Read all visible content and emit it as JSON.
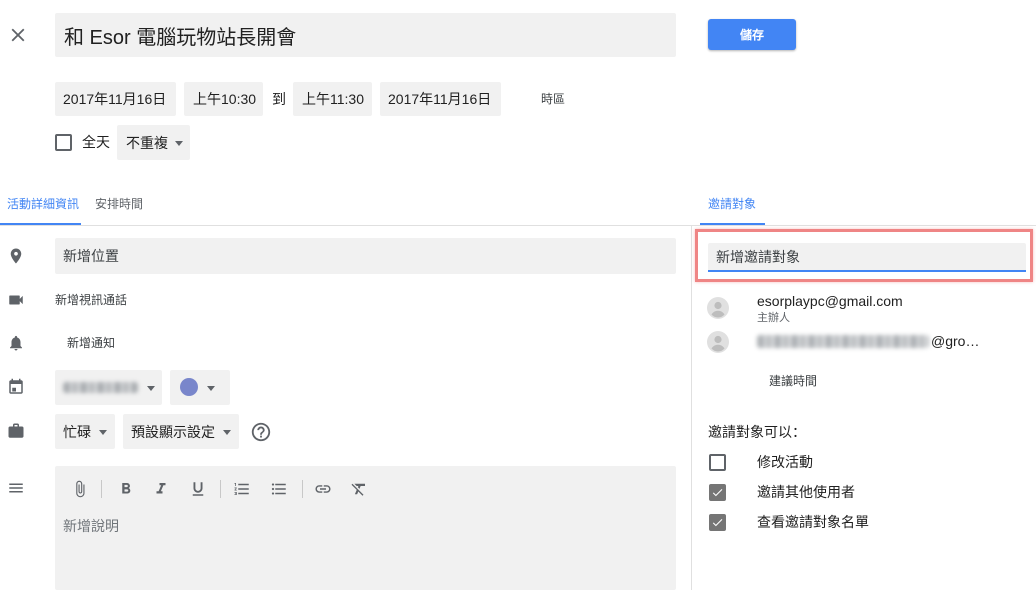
{
  "theme": {
    "accent": "#4285f4",
    "highlight_border": "#ef8585",
    "calendar_color": "#7986cb"
  },
  "icons": {
    "close": "close-icon",
    "location": "location-pin-icon",
    "video": "videocam-icon",
    "notification": "bell-icon",
    "calendar": "calendar-icon",
    "availability": "briefcase-icon",
    "help": "help-icon",
    "description": "description-lines-icon",
    "toolbar": [
      "attach-icon",
      "bold-icon",
      "italic-icon",
      "underline-icon",
      "numbered-list-icon",
      "bulleted-list-icon",
      "link-icon",
      "clear-format-icon"
    ],
    "guest_avatar": "avatar-icon"
  },
  "event": {
    "title": "和 Esor 電腦玩物站長開會",
    "save_label": "儲存",
    "start_date": "2017年11月16日",
    "start_time": "上午10:30",
    "to_label": "到",
    "end_time": "上午11:30",
    "end_date": "2017年11月16日",
    "timezone_label": "時區",
    "all_day_label": "全天",
    "all_day_checked": false,
    "repeat_value": "不重複"
  },
  "tabs": {
    "details": "活動詳細資訊",
    "find_a_time": "安排時間",
    "guests": "邀請對象"
  },
  "details": {
    "location_placeholder": "新增位置",
    "video_call_label": "新增視訊通話",
    "notification_label": "新增通知",
    "availability_value": "忙碌",
    "visibility_value": "預設顯示設定",
    "description_placeholder": "新增說明"
  },
  "guests": {
    "add_placeholder": "新增邀請對象",
    "list": [
      {
        "email": "esorplaypc@gmail.com",
        "role": "主辦人"
      },
      {
        "email_visible_part": "@gro…"
      }
    ],
    "suggest_times_label": "建議時間",
    "permissions_title": "邀請對象可以：",
    "permissions": [
      {
        "label": "修改活動",
        "checked": false
      },
      {
        "label": "邀請其他使用者",
        "checked": true
      },
      {
        "label": "查看邀請對象名單",
        "checked": true
      }
    ]
  }
}
